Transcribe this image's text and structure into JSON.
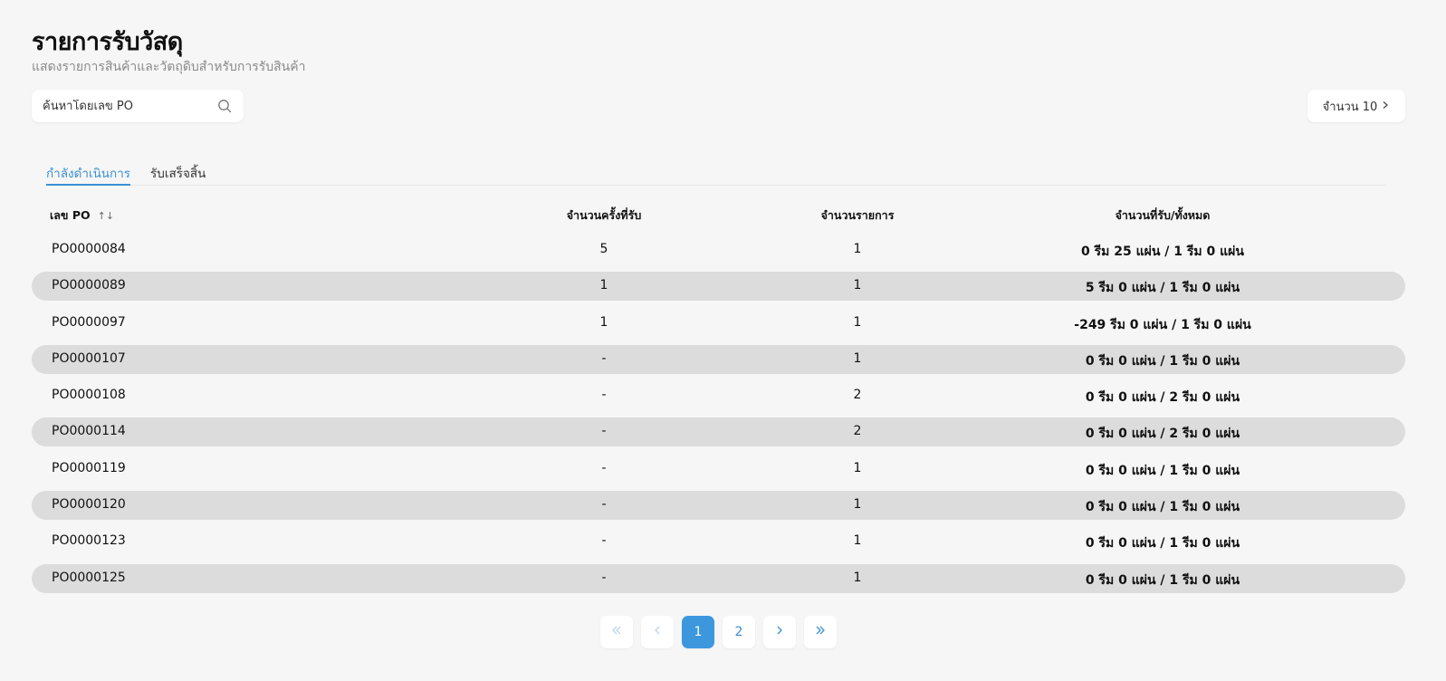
{
  "header": {
    "title": "รายการรับวัสดุ",
    "subtitle": "แสดงรายการสินค้าและวัตถุดิบสำหรับการรับสินค้า"
  },
  "search": {
    "placeholder": "ค้นหาโดยเลข PO",
    "icon": "search-icon"
  },
  "page_size": {
    "label": "จำนวน 10",
    "icon": "chevron-right-icon"
  },
  "tabs": [
    {
      "label": "กำลังดำเนินการ",
      "active": true
    },
    {
      "label": "รับเสร็จสิ้น",
      "active": false
    }
  ],
  "table": {
    "columns": {
      "po": "เลข PO",
      "receive_times": "จำนวนครั้งที่รับ",
      "item_count": "จำนวนรายการ",
      "received_total": "จำนวนที่รับ/ทั้งหมด"
    },
    "sort_icon": "sort-icon",
    "rows": [
      {
        "po": "PO0000084",
        "times": "5",
        "items": "1",
        "total": "0 รีม 25 แผ่น / 1 รีม 0 แผ่น"
      },
      {
        "po": "PO0000089",
        "times": "1",
        "items": "1",
        "total": "5 รีม 0 แผ่น / 1 รีม 0 แผ่น"
      },
      {
        "po": "PO0000097",
        "times": "1",
        "items": "1",
        "total": "-249 รีม 0 แผ่น / 1 รีม 0 แผ่น"
      },
      {
        "po": "PO0000107",
        "times": "-",
        "items": "1",
        "total": "0 รีม 0 แผ่น / 1 รีม 0 แผ่น"
      },
      {
        "po": "PO0000108",
        "times": "-",
        "items": "2",
        "total": "0 รีม 0 แผ่น / 2 รีม 0 แผ่น"
      },
      {
        "po": "PO0000114",
        "times": "-",
        "items": "2",
        "total": "0 รีม 0 แผ่น / 2 รีม 0 แผ่น"
      },
      {
        "po": "PO0000119",
        "times": "-",
        "items": "1",
        "total": "0 รีม 0 แผ่น / 1 รีม 0 แผ่น"
      },
      {
        "po": "PO0000120",
        "times": "-",
        "items": "1",
        "total": "0 รีม 0 แผ่น / 1 รีม 0 แผ่น"
      },
      {
        "po": "PO0000123",
        "times": "-",
        "items": "1",
        "total": "0 รีม 0 แผ่น / 1 รีม 0 แผ่น"
      },
      {
        "po": "PO0000125",
        "times": "-",
        "items": "1",
        "total": "0 รีม 0 แผ่น / 1 รีม 0 แผ่น"
      }
    ]
  },
  "pagination": {
    "pages": [
      "1",
      "2"
    ],
    "current": "1",
    "first_icon": "double-chevron-left-icon",
    "prev_icon": "chevron-left-icon",
    "next_icon": "chevron-right-icon",
    "last_icon": "double-chevron-right-icon"
  },
  "colors": {
    "accent": "#3d97dd",
    "striped_row": "#dcdcdc",
    "background": "#f6f6f6"
  }
}
